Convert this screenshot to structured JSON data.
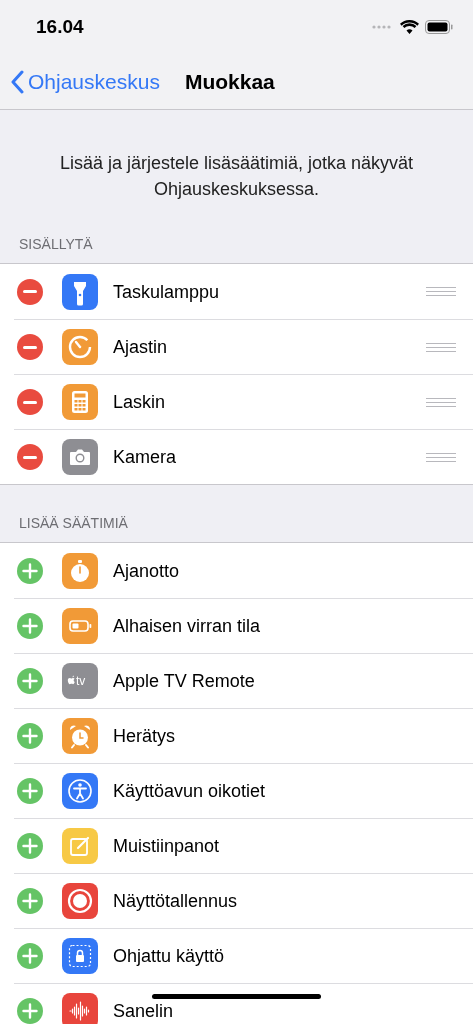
{
  "status_bar": {
    "time": "16.04"
  },
  "nav": {
    "back": "Ohjauskeskus",
    "title": "Muokkaa"
  },
  "description": "Lisää ja järjestele lisäsäätimiä, jotka näkyvät Ohjauskeskuksessa.",
  "sections": [
    {
      "header": "SISÄLLYTÄ",
      "kind": "included",
      "items": [
        {
          "label": "Taskulamppu",
          "color": "#3478f6"
        },
        {
          "label": "Ajastin",
          "color": "#f19a37"
        },
        {
          "label": "Laskin",
          "color": "#f19a37"
        },
        {
          "label": "Kamera",
          "color": "#8e8e93"
        }
      ]
    },
    {
      "header": "LISÄÄ SÄÄTIMIÄ",
      "kind": "more",
      "items": [
        {
          "label": "Ajanotto",
          "color": "#f19a37"
        },
        {
          "label": "Alhaisen virran tila",
          "color": "#f19a37"
        },
        {
          "label": "Apple TV Remote",
          "icon_text": "tv",
          "color": "#8e8e93"
        },
        {
          "label": "Herätys",
          "color": "#f19a37"
        },
        {
          "label": "Käyttöavun oikotiet",
          "color": "#3478f6"
        },
        {
          "label": "Muistiinpanot",
          "color": "#f7c945"
        },
        {
          "label": "Näyttötallennus",
          "color": "#e8453c"
        },
        {
          "label": "Ohjattu käyttö",
          "color": "#3478f6"
        },
        {
          "label": "Sanelin",
          "color": "#e8453c"
        }
      ]
    }
  ]
}
